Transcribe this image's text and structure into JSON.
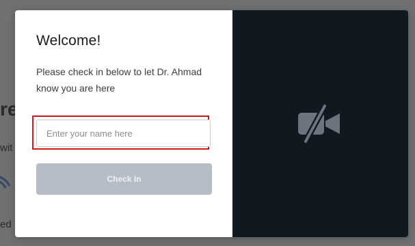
{
  "background_page": {
    "heading_fragment": "re",
    "text_fragment_1": "wit",
    "text_fragment_2": "ed"
  },
  "modal": {
    "title": "Welcome!",
    "subtitle": "Please check in below to let Dr. Ahmad know you are here",
    "name_input": {
      "placeholder": "Enter your name here",
      "value": ""
    },
    "checkin_button": {
      "label": "Check In",
      "enabled": false
    },
    "video_preview": {
      "icon": "video-off-icon"
    }
  },
  "colors": {
    "video_panel_bg": "#101820",
    "button_disabled_bg": "#b7bdc6",
    "highlight_outline": "#d4151e",
    "overlay": "#6f7072"
  }
}
